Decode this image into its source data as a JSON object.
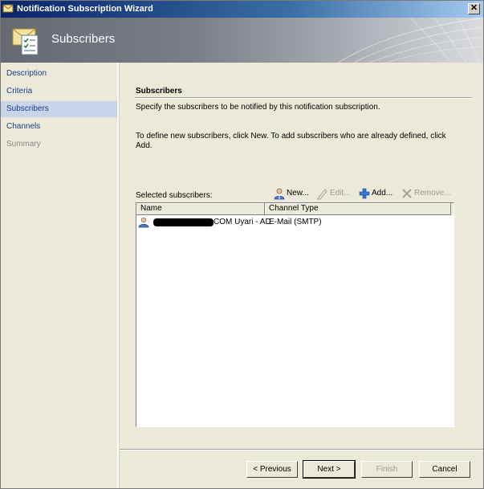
{
  "window": {
    "title": "Notification Subscription Wizard",
    "close_glyph": "✕"
  },
  "header": {
    "title": "Subscribers",
    "icon": "envelope-checklist-icon"
  },
  "sidebar": {
    "items": [
      {
        "label": "Description",
        "state": "normal"
      },
      {
        "label": "Criteria",
        "state": "normal"
      },
      {
        "label": "Subscribers",
        "state": "active"
      },
      {
        "label": "Channels",
        "state": "normal"
      },
      {
        "label": "Summary",
        "state": "disabled"
      }
    ]
  },
  "main": {
    "section_title": "Subscribers",
    "description": "Specify the subscribers to be notified by this notification subscription.",
    "instructions": "To define new subscribers, click New.  To add subscribers who are already defined, click Add.",
    "selected_label": "Selected subscribers:",
    "toolbar": {
      "new_label": "New...",
      "edit_label": "Edit...",
      "add_label": "Add...",
      "remove_label": "Remove..."
    },
    "list": {
      "columns": [
        "Name",
        "Channel Type"
      ],
      "rows": [
        {
          "name_visible": "COM Uyari - AD",
          "channel_type": "E-Mail (SMTP)"
        }
      ]
    }
  },
  "buttons": {
    "previous": "< Previous",
    "next": "Next >",
    "finish": "Finish",
    "cancel": "Cancel"
  },
  "colors": {
    "title_bar": "#0a246a",
    "sidebar_link": "#1a3d8a",
    "sidebar_active_bg": "#c8d4e8",
    "panel_bg": "#ece9d8"
  }
}
